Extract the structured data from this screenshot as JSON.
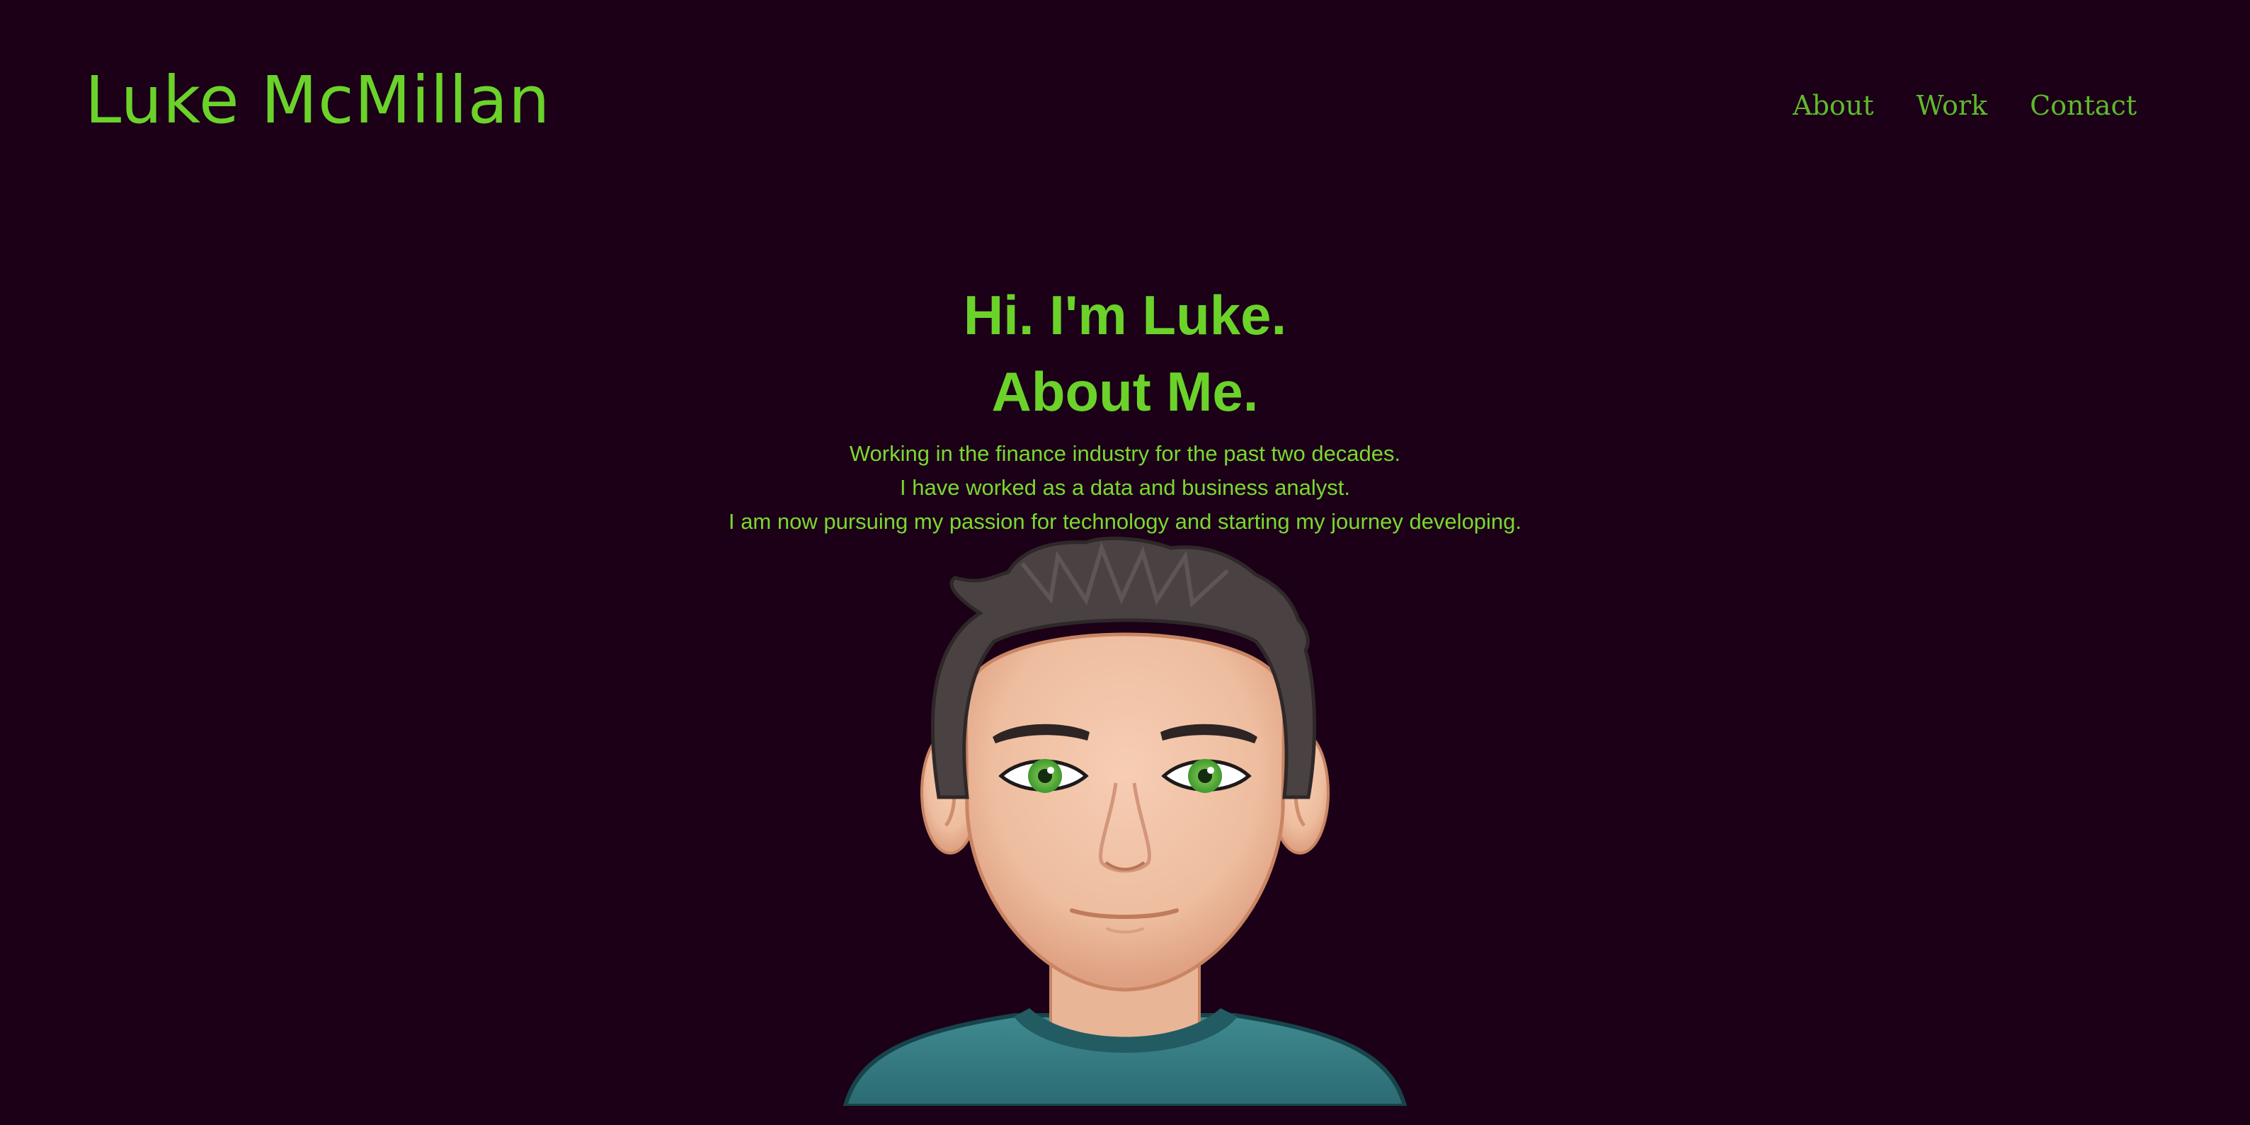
{
  "header": {
    "brand": "Luke McMillan",
    "nav": [
      {
        "label": "About"
      },
      {
        "label": "Work"
      },
      {
        "label": "Contact"
      }
    ]
  },
  "hero": {
    "greeting": "Hi. I'm Luke.",
    "heading": "About Me.",
    "bio": [
      "Working in the finance industry for the past two decades.",
      "I have worked as a data and business analyst.",
      "I am now pursuing my passion for technology and starting my journey developing."
    ]
  },
  "avatar": {
    "icon": "memoji-avatar-icon"
  },
  "colors": {
    "background": "#1b0018",
    "accent": "#6bd22a",
    "nav": "#5fba2b"
  }
}
